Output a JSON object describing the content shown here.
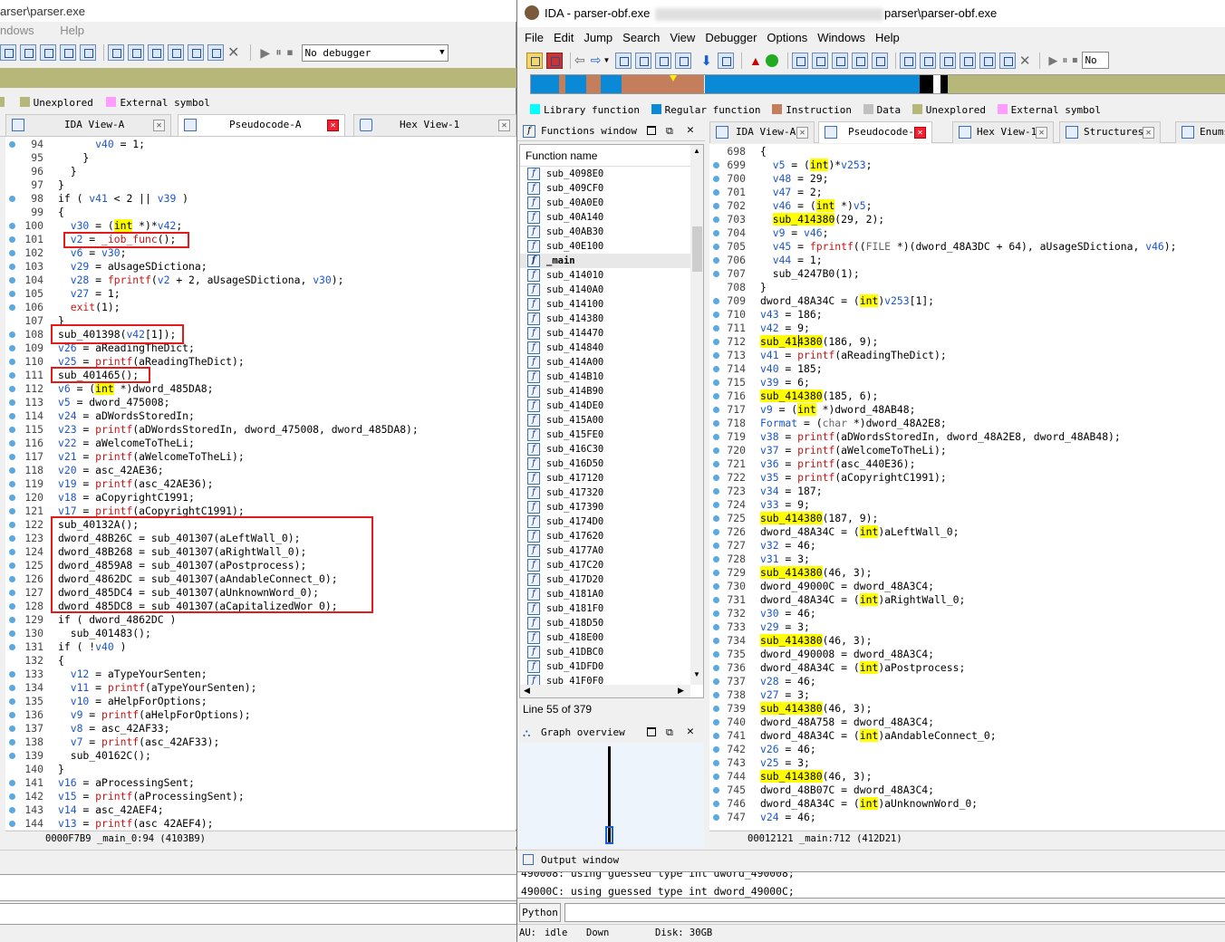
{
  "left": {
    "title_path": "arser\\parser.exe",
    "menu": [
      "ndows",
      "Help"
    ],
    "debugger_select": "No debugger",
    "legend": [
      {
        "label": "Unexplored",
        "color": "#b7b77a"
      },
      {
        "label": "External symbol",
        "color": "#ff9cff"
      }
    ],
    "tabs": [
      {
        "label": "IDA View-A"
      },
      {
        "label": "Pseudocode-A"
      },
      {
        "label": "Hex View-1"
      }
    ],
    "status": "0000F7B9 _main_0:94 (4103B9)"
  },
  "right": {
    "title": "IDA - parser-obf.exe",
    "title_suffix": "parser\\parser-obf.exe",
    "menu": [
      "File",
      "Edit",
      "Jump",
      "Search",
      "View",
      "Debugger",
      "Options",
      "Windows",
      "Help"
    ],
    "debugger_select": "No",
    "legend": [
      {
        "label": "Library function",
        "color": "#00ffff"
      },
      {
        "label": "Regular function",
        "color": "#0a8ad6"
      },
      {
        "label": "Instruction",
        "color": "#c57e5b"
      },
      {
        "label": "Data",
        "color": "#c0c0c0"
      },
      {
        "label": "Unexplored",
        "color": "#b7b77a"
      },
      {
        "label": "External symbol",
        "color": "#ff9cff"
      }
    ],
    "functions_window": {
      "title": "Functions window",
      "column": "Function name",
      "items": [
        "sub_4098E0",
        "sub_409CF0",
        "sub_40A0E0",
        "sub_40A140",
        "sub_40AB30",
        "sub_40E100",
        "_main",
        "sub_414010",
        "sub_4140A0",
        "sub_414100",
        "sub_414380",
        "sub_414470",
        "sub_414840",
        "sub_414A00",
        "sub_414B10",
        "sub_414B90",
        "sub_414DE0",
        "sub_415A00",
        "sub_415FE0",
        "sub_416C30",
        "sub_416D50",
        "sub_417120",
        "sub_417320",
        "sub_417390",
        "sub_4174D0",
        "sub_417620",
        "sub_4177A0",
        "sub_417C20",
        "sub_417D20",
        "sub_4181A0",
        "sub_4181F0",
        "sub_418D50",
        "sub_418E00",
        "sub_41DBC0",
        "sub_41DFD0",
        "sub_41F0F0"
      ],
      "line_info": "Line 55 of 379"
    },
    "graph_overview": {
      "title": "Graph overview"
    },
    "tabs": [
      {
        "label": "IDA View-A"
      },
      {
        "label": "Pseudocode-A"
      },
      {
        "label": "Hex View-1"
      },
      {
        "label": "Structures"
      },
      {
        "label": "Enums"
      }
    ],
    "status": "00012121 _main:712 (412D21)",
    "output": {
      "title": "Output window",
      "lines": [
        "490008: using guessed type int dword_490008;",
        "49000C: using guessed type int dword_49000C;"
      ],
      "python_label": "Python"
    },
    "statusbar": {
      "au": "AU:",
      "state": "idle",
      "dir": "Down",
      "disk": "Disk: 30GB"
    }
  },
  "left_code": [
    {
      "n": "94",
      "d": true,
      "t": "      v40 = 1;"
    },
    {
      "n": "95",
      "d": false,
      "t": "    }"
    },
    {
      "n": "96",
      "d": false,
      "t": "  }"
    },
    {
      "n": "97",
      "d": false,
      "t": "}"
    },
    {
      "n": "98",
      "d": true,
      "t": "if ( v41 < 2 || v39 )"
    },
    {
      "n": "99",
      "d": false,
      "t": "{"
    },
    {
      "n": "100",
      "d": true,
      "t": "  v30 = (int *)*v42;"
    },
    {
      "n": "101",
      "d": true,
      "t": "  v2 = _iob_func();"
    },
    {
      "n": "102",
      "d": true,
      "t": "  v6 = v30;"
    },
    {
      "n": "103",
      "d": true,
      "t": "  v29 = aUsageSDictiona;"
    },
    {
      "n": "104",
      "d": true,
      "t": "  v28 = fprintf(v2 + 2, aUsageSDictiona, v30);"
    },
    {
      "n": "105",
      "d": true,
      "t": "  v27 = 1;"
    },
    {
      "n": "106",
      "d": true,
      "t": "  exit(1);"
    },
    {
      "n": "107",
      "d": false,
      "t": "}"
    },
    {
      "n": "108",
      "d": true,
      "t": "sub_401398(v42[1]);"
    },
    {
      "n": "109",
      "d": true,
      "t": "v26 = aReadingTheDict;"
    },
    {
      "n": "110",
      "d": true,
      "t": "v25 = printf(aReadingTheDict);"
    },
    {
      "n": "111",
      "d": true,
      "t": "sub_401465();"
    },
    {
      "n": "112",
      "d": true,
      "t": "v6 = (int *)dword_485DA8;"
    },
    {
      "n": "113",
      "d": true,
      "t": "v5 = dword_475008;"
    },
    {
      "n": "114",
      "d": true,
      "t": "v24 = aDWordsStoredIn;"
    },
    {
      "n": "115",
      "d": true,
      "t": "v23 = printf(aDWordsStoredIn, dword_475008, dword_485DA8);"
    },
    {
      "n": "116",
      "d": true,
      "t": "v22 = aWelcomeToTheLi;"
    },
    {
      "n": "117",
      "d": true,
      "t": "v21 = printf(aWelcomeToTheLi);"
    },
    {
      "n": "118",
      "d": true,
      "t": "v20 = asc_42AE36;"
    },
    {
      "n": "119",
      "d": true,
      "t": "v19 = printf(asc_42AE36);"
    },
    {
      "n": "120",
      "d": true,
      "t": "v18 = aCopyrightC1991;"
    },
    {
      "n": "121",
      "d": true,
      "t": "v17 = printf(aCopyrightC1991);"
    },
    {
      "n": "122",
      "d": true,
      "t": "sub_40132A();"
    },
    {
      "n": "123",
      "d": true,
      "t": "dword_48B26C = sub_401307(aLeftWall_0);"
    },
    {
      "n": "124",
      "d": true,
      "t": "dword_48B268 = sub_401307(aRightWall_0);"
    },
    {
      "n": "125",
      "d": true,
      "t": "dword_4859A8 = sub_401307(aPostprocess);"
    },
    {
      "n": "126",
      "d": true,
      "t": "dword_4862DC = sub_401307(aAndableConnect_0);"
    },
    {
      "n": "127",
      "d": true,
      "t": "dword_485DC4 = sub_401307(aUnknownWord_0);"
    },
    {
      "n": "128",
      "d": true,
      "t": "dword_485DC8 = sub_401307(aCapitalizedWor_0);"
    },
    {
      "n": "129",
      "d": true,
      "t": "if ( dword_4862DC )"
    },
    {
      "n": "130",
      "d": true,
      "t": "  sub_401483();"
    },
    {
      "n": "131",
      "d": true,
      "t": "if ( !v40 )"
    },
    {
      "n": "132",
      "d": false,
      "t": "{"
    },
    {
      "n": "133",
      "d": true,
      "t": "  v12 = aTypeYourSenten;"
    },
    {
      "n": "134",
      "d": true,
      "t": "  v11 = printf(aTypeYourSenten);"
    },
    {
      "n": "135",
      "d": true,
      "t": "  v10 = aHelpForOptions;"
    },
    {
      "n": "136",
      "d": true,
      "t": "  v9 = printf(aHelpForOptions);"
    },
    {
      "n": "137",
      "d": true,
      "t": "  v8 = asc_42AF33;"
    },
    {
      "n": "138",
      "d": true,
      "t": "  v7 = printf(asc_42AF33);"
    },
    {
      "n": "139",
      "d": true,
      "t": "  sub_40162C();"
    },
    {
      "n": "140",
      "d": false,
      "t": "}"
    },
    {
      "n": "141",
      "d": true,
      "t": "v16 = aProcessingSent;"
    },
    {
      "n": "142",
      "d": true,
      "t": "v15 = printf(aProcessingSent);"
    },
    {
      "n": "143",
      "d": true,
      "t": "v14 = asc_42AEF4;"
    },
    {
      "n": "144",
      "d": true,
      "t": "v13 = printf(asc 42AEF4);"
    }
  ],
  "right_code": [
    {
      "n": "698",
      "d": false,
      "t": "{"
    },
    {
      "n": "699",
      "d": true,
      "t": "  v5 = (int)*v253;"
    },
    {
      "n": "700",
      "d": true,
      "t": "  v48 = 29;"
    },
    {
      "n": "701",
      "d": true,
      "t": "  v47 = 2;"
    },
    {
      "n": "702",
      "d": true,
      "t": "  v46 = (int *)v5;"
    },
    {
      "n": "703",
      "d": true,
      "t": "  sub_414380(29, 2);",
      "h": "sub_414380"
    },
    {
      "n": "704",
      "d": true,
      "t": "  v9 = v46;"
    },
    {
      "n": "705",
      "d": true,
      "t": "  v45 = fprintf((FILE *)(dword_48A3DC + 64), aUsageSDictiona, v46);"
    },
    {
      "n": "706",
      "d": true,
      "t": "  v44 = 1;"
    },
    {
      "n": "707",
      "d": true,
      "t": "  sub_4247B0(1);"
    },
    {
      "n": "708",
      "d": false,
      "t": "}"
    },
    {
      "n": "709",
      "d": true,
      "t": "dword_48A34C = (int)v253[1];"
    },
    {
      "n": "710",
      "d": true,
      "t": "v43 = 186;"
    },
    {
      "n": "711",
      "d": true,
      "t": "v42 = 9;"
    },
    {
      "n": "712",
      "d": true,
      "t": "sub_414380(186, 9);",
      "h": "sub_414380"
    },
    {
      "n": "713",
      "d": true,
      "t": "v41 = printf(aReadingTheDict);"
    },
    {
      "n": "714",
      "d": true,
      "t": "v40 = 185;"
    },
    {
      "n": "715",
      "d": true,
      "t": "v39 = 6;"
    },
    {
      "n": "716",
      "d": true,
      "t": "sub_414380(185, 6);",
      "h": "sub_414380"
    },
    {
      "n": "717",
      "d": true,
      "t": "v9 = (int *)dword_48AB48;"
    },
    {
      "n": "718",
      "d": true,
      "t": "Format = (char *)dword_48A2E8;"
    },
    {
      "n": "719",
      "d": true,
      "t": "v38 = printf(aDWordsStoredIn, dword_48A2E8, dword_48AB48);"
    },
    {
      "n": "720",
      "d": true,
      "t": "v37 = printf(aWelcomeToTheLi);"
    },
    {
      "n": "721",
      "d": true,
      "t": "v36 = printf(asc_440E36);"
    },
    {
      "n": "722",
      "d": true,
      "t": "v35 = printf(aCopyrightC1991);"
    },
    {
      "n": "723",
      "d": true,
      "t": "v34 = 187;"
    },
    {
      "n": "724",
      "d": true,
      "t": "v33 = 9;"
    },
    {
      "n": "725",
      "d": true,
      "t": "sub_414380(187, 9);",
      "h": "sub_414380"
    },
    {
      "n": "726",
      "d": true,
      "t": "dword_48A34C = (int)aLeftWall_0;"
    },
    {
      "n": "727",
      "d": true,
      "t": "v32 = 46;"
    },
    {
      "n": "728",
      "d": true,
      "t": "v31 = 3;"
    },
    {
      "n": "729",
      "d": true,
      "t": "sub_414380(46, 3);",
      "h": "sub_414380"
    },
    {
      "n": "730",
      "d": true,
      "t": "dword_49000C = dword_48A3C4;"
    },
    {
      "n": "731",
      "d": true,
      "t": "dword_48A34C = (int)aRightWall_0;"
    },
    {
      "n": "732",
      "d": true,
      "t": "v30 = 46;"
    },
    {
      "n": "733",
      "d": true,
      "t": "v29 = 3;"
    },
    {
      "n": "734",
      "d": true,
      "t": "sub_414380(46, 3);",
      "h": "sub_414380"
    },
    {
      "n": "735",
      "d": true,
      "t": "dword_490008 = dword_48A3C4;"
    },
    {
      "n": "736",
      "d": true,
      "t": "dword_48A34C = (int)aPostprocess;"
    },
    {
      "n": "737",
      "d": true,
      "t": "v28 = 46;"
    },
    {
      "n": "738",
      "d": true,
      "t": "v27 = 3;"
    },
    {
      "n": "739",
      "d": true,
      "t": "sub_414380(46, 3);",
      "h": "sub_414380"
    },
    {
      "n": "740",
      "d": true,
      "t": "dword_48A758 = dword_48A3C4;"
    },
    {
      "n": "741",
      "d": true,
      "t": "dword_48A34C = (int)aAndableConnect_0;"
    },
    {
      "n": "742",
      "d": true,
      "t": "v26 = 46;"
    },
    {
      "n": "743",
      "d": true,
      "t": "v25 = 3;"
    },
    {
      "n": "744",
      "d": true,
      "t": "sub_414380(46, 3);",
      "h": "sub_414380"
    },
    {
      "n": "745",
      "d": true,
      "t": "dword_48B07C = dword_48A3C4;"
    },
    {
      "n": "746",
      "d": true,
      "t": "dword_48A34C = (int)aUnknownWord_0;"
    },
    {
      "n": "747",
      "d": true,
      "t": "v24 = 46;"
    }
  ]
}
